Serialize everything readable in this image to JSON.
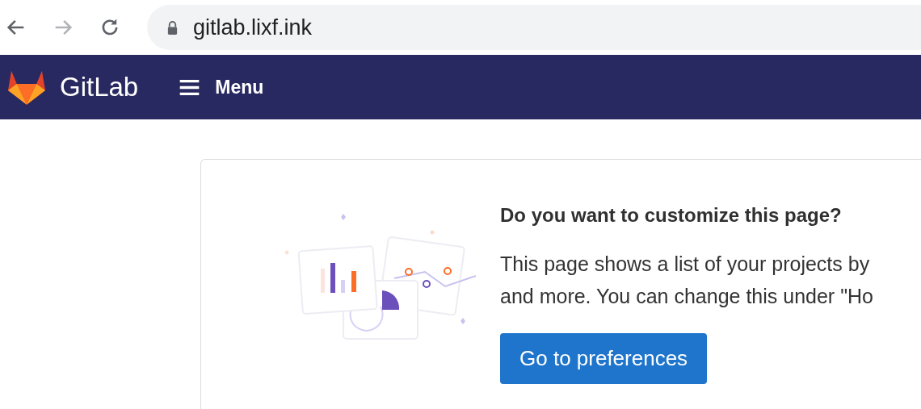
{
  "browser": {
    "url": "gitlab.lixf.ink"
  },
  "header": {
    "brand": "GitLab",
    "menu_label": "Menu"
  },
  "card": {
    "title": "Do you want to customize this page?",
    "body_lines": [
      "This page shows a list of your projects by",
      "and more. You can change this under \"Ho"
    ],
    "button": "Go to preferences"
  }
}
